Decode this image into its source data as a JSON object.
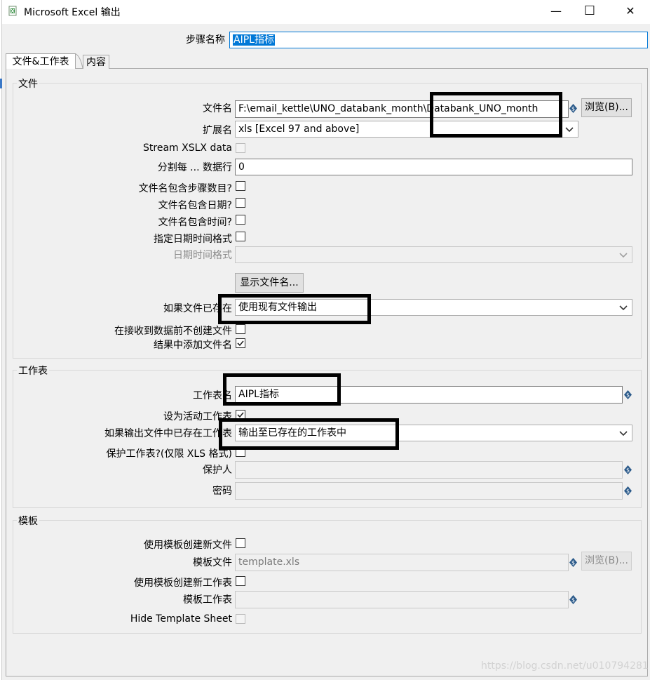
{
  "window": {
    "title": "Microsoft Excel 输出",
    "minimize": "—",
    "maximize": "☐",
    "close": "✕"
  },
  "step_name": {
    "label": "步骤名称",
    "value": "AIPL指标"
  },
  "tabs": [
    {
      "label": "文件&工作表"
    },
    {
      "label": "内容"
    }
  ],
  "file_group": {
    "legend": "文件",
    "filename": {
      "label": "文件名",
      "value": "F:\\email_kettle\\UNO_databank_month\\Databank_UNO_month"
    },
    "browse_label": "浏览(B)...",
    "extension": {
      "label": "扩展名",
      "value": "xls [Excel 97 and above]"
    },
    "stream_xslx_label": "Stream XSLX data",
    "split_every": {
      "label": "分割每 ... 数据行",
      "value": "0"
    },
    "include_stepnr_label": "文件名包含步骤数目?",
    "include_date_label": "文件名包含日期?",
    "include_time_label": "文件名包含时间?",
    "specify_format_label": "指定日期时间格式",
    "date_format_label": "日期时间格式",
    "show_filenames_label": "显示文件名...",
    "if_file_exists": {
      "label": "如果文件已存在",
      "value": "使用现有文件输出"
    },
    "no_create_label": "在接收到数据前不创建文件",
    "add_to_result_label": "结果中添加文件名"
  },
  "sheet_group": {
    "legend": "工作表",
    "sheet_name": {
      "label": "工作表名",
      "value": "AIPL指标"
    },
    "make_active_label": "设为活动工作表",
    "if_sheet_exists": {
      "label": "如果输出文件中已存在工作表",
      "value": "输出至已存在的工作表中"
    },
    "protect_label": "保护工作表?(仅限 XLS 格式)",
    "protected_by_label": "保护人",
    "password_label": "密码"
  },
  "template_group": {
    "legend": "模板",
    "use_template_label": "使用模板创建新文件",
    "template_file": {
      "label": "模板文件",
      "value": "template.xls"
    },
    "browse_label": "浏览(B)...",
    "use_template_sheet_label": "使用模板创建新工作表",
    "template_sheet_label": "模板工作表",
    "hide_template_label": "Hide Template Sheet"
  },
  "watermark": "https://blog.csdn.net/u010794281",
  "colors": {
    "selection": "#0078d7",
    "highlight_box": "#000000"
  }
}
